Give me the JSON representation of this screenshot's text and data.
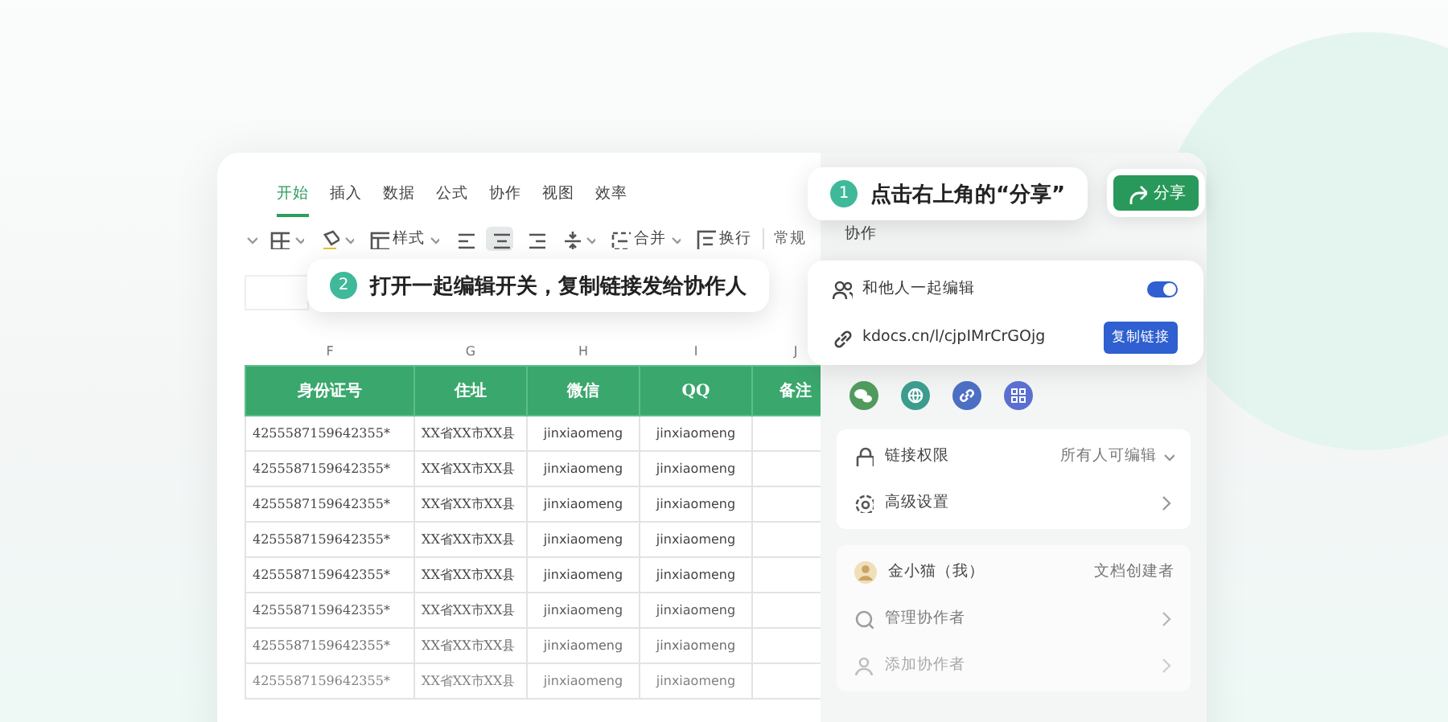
{
  "menu_tabs": [
    {
      "label": "开始",
      "selected": true
    },
    {
      "label": "插入",
      "selected": false
    },
    {
      "label": "数据",
      "selected": false
    },
    {
      "label": "公式",
      "selected": false
    },
    {
      "label": "协作",
      "selected": false
    },
    {
      "label": "视图",
      "selected": false
    },
    {
      "label": "效率",
      "selected": false
    }
  ],
  "toolbar": [
    {
      "kind": "caret"
    },
    {
      "kind": "grid"
    },
    {
      "kind": "fill"
    },
    {
      "kind": "style",
      "label": "样式"
    },
    {
      "kind": "align-left",
      "selected": false
    },
    {
      "kind": "align-center",
      "selected": true
    },
    {
      "kind": "align-right",
      "selected": false
    },
    {
      "kind": "valign"
    },
    {
      "kind": "merge",
      "label": "合并"
    },
    {
      "kind": "wrap",
      "label": "换行"
    },
    {
      "kind": "text",
      "label": "常规"
    }
  ],
  "sheet": {
    "column_letters": [
      "F",
      "G",
      "H",
      "I",
      "J"
    ],
    "headers": [
      "身份证号",
      "住址",
      "微信",
      "QQ",
      "备注"
    ],
    "rows": [
      [
        "4255587159642355*",
        "XX省XX市XX县",
        "jinxiaomeng",
        "jinxiaomeng",
        ""
      ],
      [
        "4255587159642355*",
        "XX省XX市XX县",
        "jinxiaomeng",
        "jinxiaomeng",
        ""
      ],
      [
        "4255587159642355*",
        "XX省XX市XX县",
        "jinxiaomeng",
        "jinxiaomeng",
        ""
      ],
      [
        "4255587159642355*",
        "XX省XX市XX县",
        "jinxiaomeng",
        "jinxiaomeng",
        ""
      ],
      [
        "4255587159642355*",
        "XX省XX市XX县",
        "jinxiaomeng",
        "jinxiaomeng",
        ""
      ],
      [
        "4255587159642355*",
        "XX省XX市XX县",
        "jinxiaomeng",
        "jinxiaomeng",
        ""
      ],
      [
        "4255587159642355*",
        "XX省XX市XX县",
        "jinxiaomeng",
        "jinxiaomeng",
        ""
      ],
      [
        "4255587159642355*",
        "XX省XX市XX县",
        "jinxiaomeng",
        "jinxiaomeng",
        ""
      ]
    ]
  },
  "share_panel": {
    "title": "协作",
    "popup": {
      "edit_together": {
        "label": "和他人一起编辑",
        "on": true
      },
      "link": "kdocs.cn/l/cjpIMrCrGOjg",
      "copy_button": "复制链接"
    },
    "share_icons": [
      {
        "kind": "wechat",
        "color": "#4f9a5c"
      },
      {
        "kind": "globe",
        "color": "#3c9c8e"
      },
      {
        "kind": "link",
        "color": "#4c6fc4"
      },
      {
        "kind": "qr",
        "color": "#5a6fd0"
      }
    ],
    "permission": {
      "label": "链接权限",
      "value": "所有人可编辑"
    },
    "advanced": {
      "label": "高级设置"
    },
    "owner": {
      "name": "金小猫（我）",
      "role": "文档创建者"
    },
    "actions": [
      {
        "label": "管理协作者"
      },
      {
        "label": "添加协作者"
      }
    ]
  },
  "share_button": {
    "label": "分享"
  },
  "steps": [
    {
      "number": "1",
      "text": "点击右上角的“分享”"
    },
    {
      "number": "2",
      "text": "打开一起编辑开关，复制链接发给协作人"
    }
  ]
}
